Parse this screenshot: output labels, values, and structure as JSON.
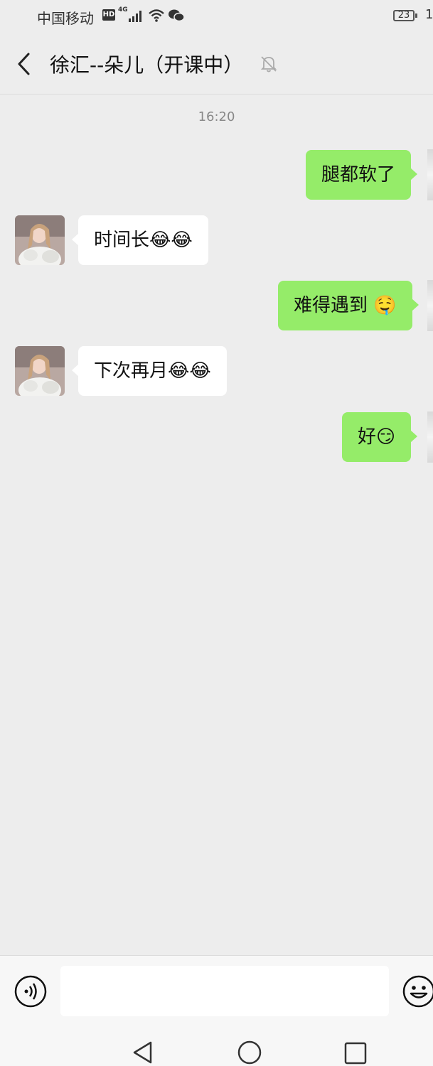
{
  "status_bar": {
    "carrier": "中国移动",
    "hd": "HD",
    "network": "4G",
    "battery": "23",
    "clock_fragment": "1"
  },
  "header": {
    "title": "徐汇--朵儿（开课中）"
  },
  "chat": {
    "time_separator": "16:20",
    "messages": [
      {
        "side": "out",
        "text": "腿都软了",
        "emoji": ""
      },
      {
        "side": "in",
        "text": "时间长",
        "emoji": "😂😂"
      },
      {
        "side": "out",
        "text": "难得遇到",
        "emoji": "🤤"
      },
      {
        "side": "in",
        "text": "下次再月",
        "emoji": "😂😂"
      },
      {
        "side": "out",
        "text": "好",
        "emoji": "😏"
      }
    ]
  },
  "input": {
    "value": "",
    "placeholder": ""
  },
  "colors": {
    "outgoing_bubble": "#95ec69",
    "incoming_bubble": "#ffffff",
    "background": "#ededed"
  }
}
